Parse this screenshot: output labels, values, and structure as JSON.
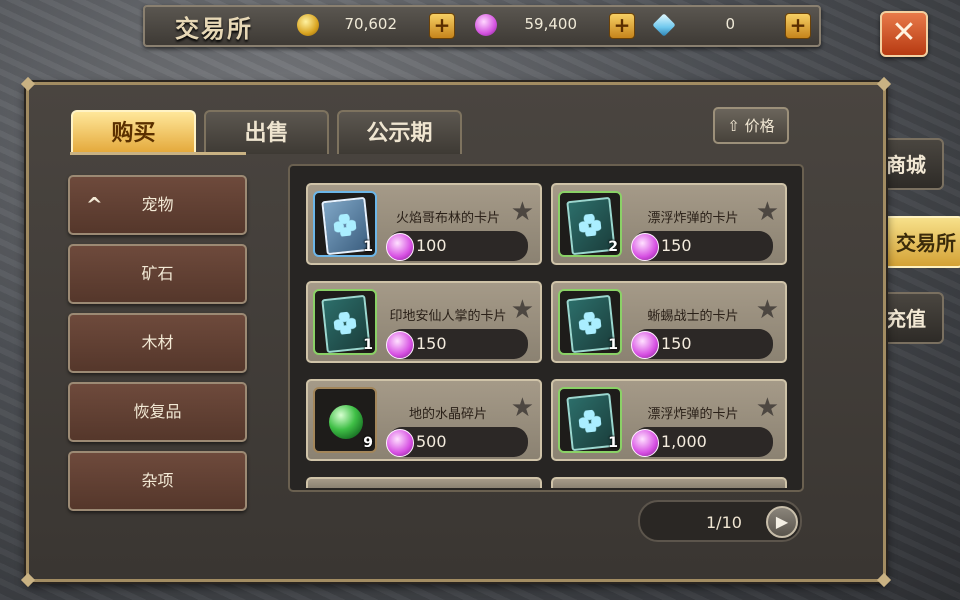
{
  "header": {
    "title": "交易所"
  },
  "currencies": [
    {
      "icon": "gold-coin-icon",
      "amount": "70,602"
    },
    {
      "icon": "purple-gem-icon",
      "amount": "59,400"
    },
    {
      "icon": "diamond-icon",
      "amount": "0"
    }
  ],
  "plus_label": "+",
  "close_label": "✕",
  "side_tabs": [
    "商城",
    "交易所",
    "充值"
  ],
  "tabs": [
    "购买",
    "出售",
    "公示期"
  ],
  "sort_button": "价格",
  "sort_arrow": "⇧",
  "categories": [
    "宠物",
    "矿石",
    "木材",
    "恢复品",
    "杂项"
  ],
  "items": [
    {
      "name": "火焰哥布林的卡片",
      "qty": "1",
      "price": "100",
      "icon": "card-icon"
    },
    {
      "name": "漂浮炸弹的卡片",
      "qty": "2",
      "price": "150",
      "icon": "card-icon"
    },
    {
      "name": "印地安仙人掌的卡片",
      "qty": "1",
      "price": "150",
      "icon": "card-icon"
    },
    {
      "name": "蜥蜴战士的卡片",
      "qty": "1",
      "price": "150",
      "icon": "card-icon"
    },
    {
      "name": "地的水晶碎片",
      "qty": "9",
      "price": "500",
      "icon": "green-orb-icon"
    },
    {
      "name": "漂浮炸弹的卡片",
      "qty": "1",
      "price": "1,000",
      "icon": "card-icon"
    }
  ],
  "pagination": {
    "text": "1/10"
  },
  "colors": {
    "accent": "#e3a738",
    "frame": "#a28c62"
  }
}
